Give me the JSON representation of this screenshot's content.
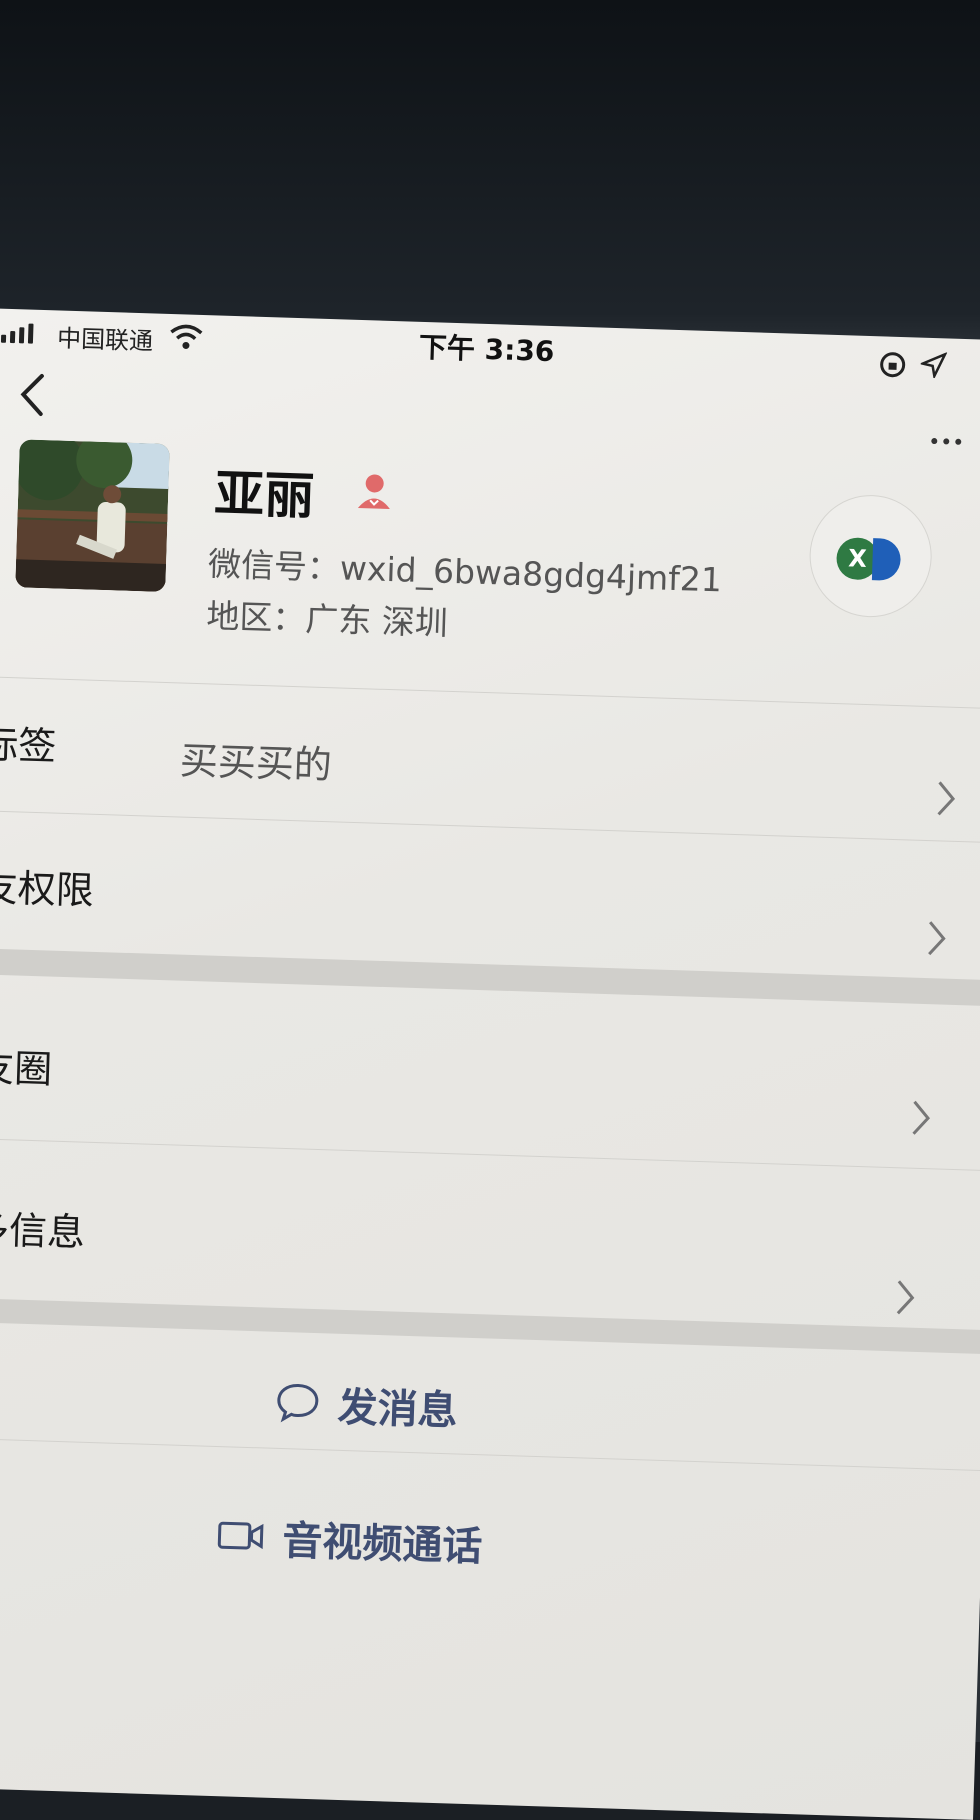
{
  "status_bar": {
    "carrier": "中国联通",
    "time": "下午 3:36"
  },
  "profile": {
    "name": "亚丽",
    "wechat_id": "微信号：wxid_6bwa8gdg4jmf21",
    "region": "地区：广东 深圳"
  },
  "widget": {
    "badge": "X"
  },
  "rows": {
    "tags": {
      "label": "标签",
      "value": "买买买的"
    },
    "friend_permissions": {
      "label": "朋友权限"
    },
    "moments": {
      "label": "朋友圈"
    },
    "more_info": {
      "label": "更多信息"
    }
  },
  "actions": {
    "send_message": "发消息",
    "video_call": "音视频通话"
  },
  "colors": {
    "action_text": "#3f4d72",
    "gender_icon": "#e06a6a",
    "widget_badge": "#2f7a43"
  }
}
